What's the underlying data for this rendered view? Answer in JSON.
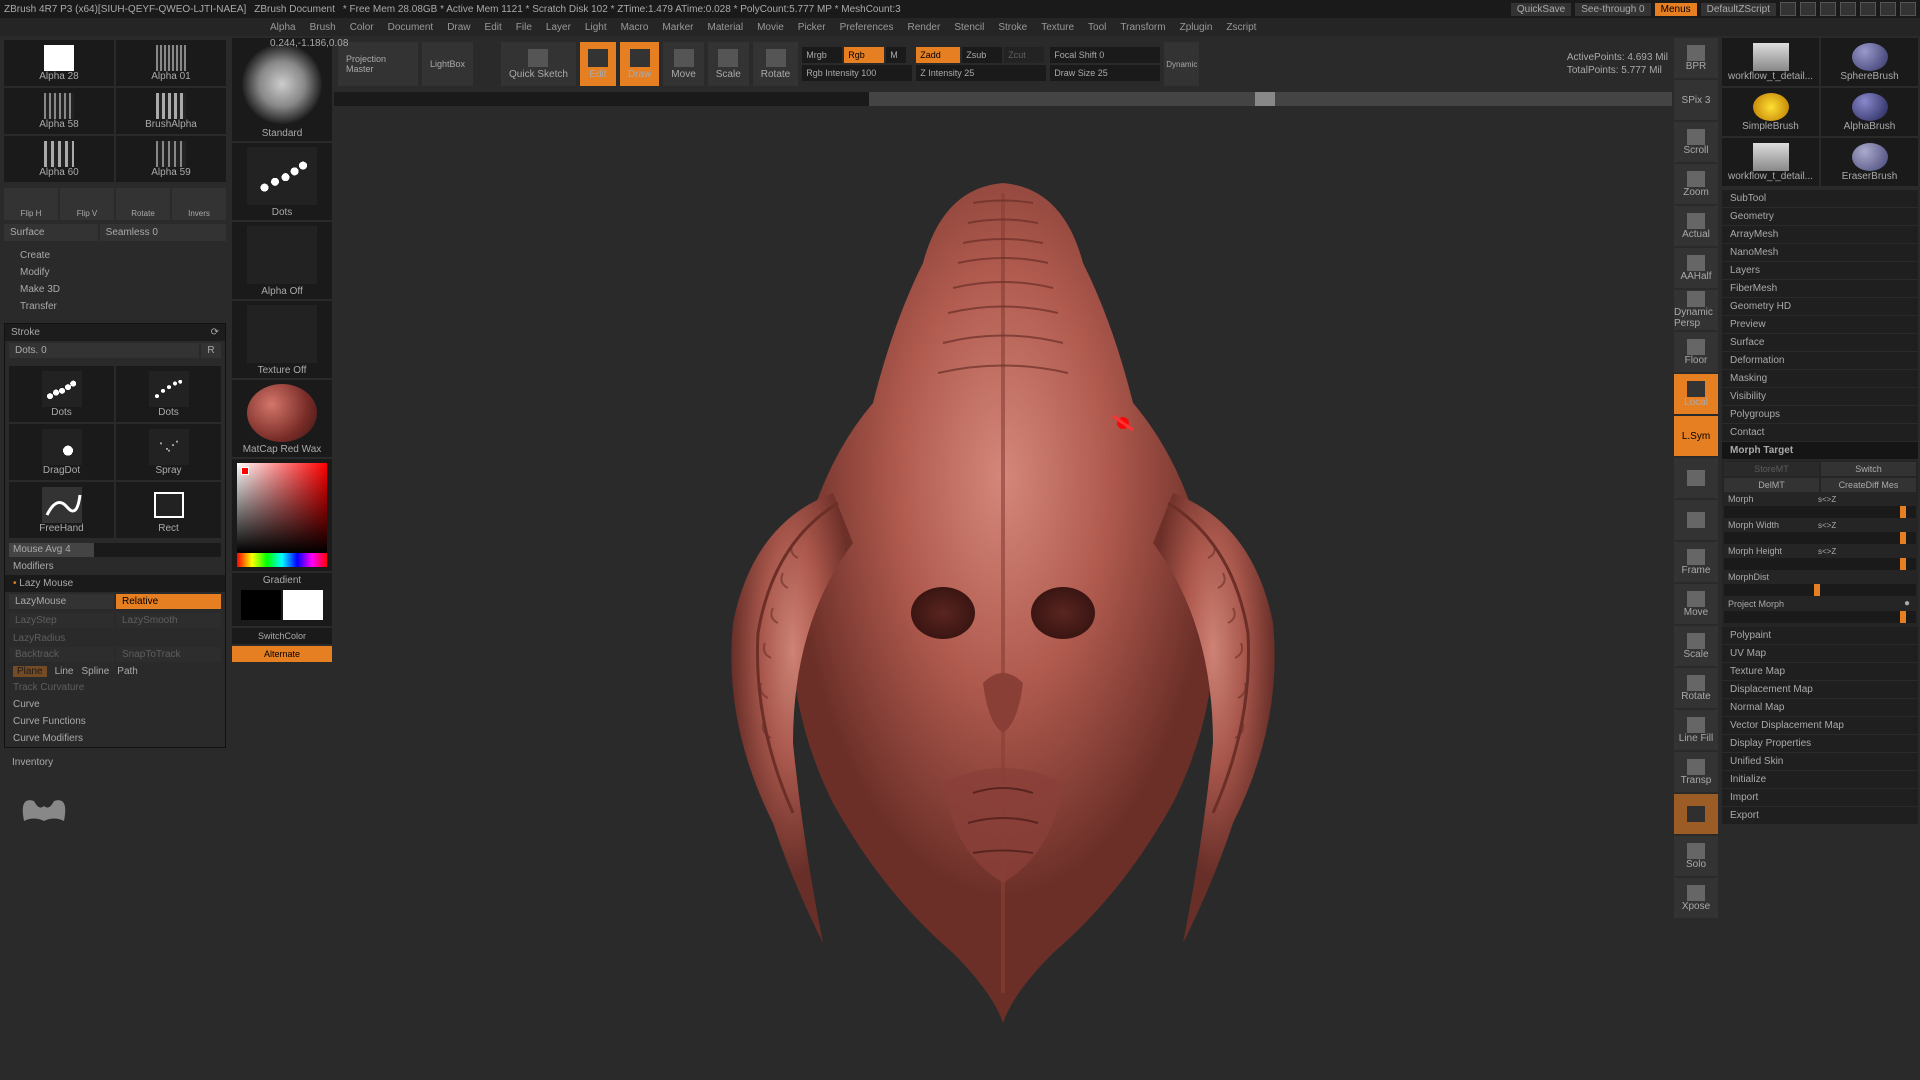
{
  "topbar": {
    "title": "ZBrush 4R7 P3  (x64)[SIUH-QEYF-QWEO-LJTI-NAEA]",
    "doc": "ZBrush Document",
    "stats": "* Free Mem 28.08GB * Active Mem 1121 * Scratch Disk 102 * ZTime:1.479 ATime:0.028 * PolyCount:5.777 MP * MeshCount:3",
    "quicksave": "QuickSave",
    "seethrough": "See-through  0",
    "menus": "Menus",
    "defaultz": "DefaultZScript"
  },
  "menu": [
    "Alpha",
    "Brush",
    "Color",
    "Document",
    "Draw",
    "Edit",
    "File",
    "Layer",
    "Light",
    "Macro",
    "Marker",
    "Material",
    "Movie",
    "Picker",
    "Preferences",
    "Render",
    "Stencil",
    "Stroke",
    "Texture",
    "Tool",
    "Transform",
    "Zplugin",
    "Zscript"
  ],
  "coord": "0.244,-1.186,0.08",
  "alphas": [
    "Alpha 28",
    "Alpha 58",
    "Alpha 60",
    "BrushAlpha",
    "Alpha 01",
    "Alpha 59"
  ],
  "flip": [
    "Flip H",
    "Flip V",
    "Rotate",
    "Invers"
  ],
  "surface": "Surface",
  "seamless": "Seamless 0",
  "actions": [
    "Create",
    "Modify",
    "Make 3D",
    "Transfer"
  ],
  "stroke": {
    "title": "Stroke",
    "dots": "Dots. 0",
    "r": "R",
    "types": [
      "Dots",
      "Dots",
      "DragDot",
      "Spray",
      "FreeHand",
      "Rect"
    ],
    "mouseavg": "Mouse Avg 4",
    "modifiers": "Modifiers",
    "lazymouse": "Lazy Mouse",
    "lazymouse_btn": "LazyMouse",
    "relative": "Relative",
    "lazystep": "LazyStep",
    "lazysmooth": "LazySmooth",
    "lazyradius": "LazyRadius",
    "backtrack": "Backtrack",
    "snaptotrack": "SnapToTrack",
    "opts": [
      "Plane",
      "Line",
      "Spline",
      "Path"
    ],
    "trackcurv": "Track Curvature",
    "curve": "Curve",
    "curvefn": "Curve Functions",
    "curvemod": "Curve Modifiers"
  },
  "inventory": "Inventory",
  "mid": {
    "standard": "Standard",
    "dotslbl": "Dots",
    "alphaoff": "Alpha Off",
    "texoff": "Texture Off",
    "material": "MatCap Red Wax",
    "gradient": "Gradient",
    "switchcolor": "SwitchColor",
    "alternate": "Alternate"
  },
  "tb": {
    "projmaster": "Projection Master",
    "lightbox": "LightBox",
    "quicksketch": "Quick Sketch",
    "edit": "Edit",
    "draw": "Draw",
    "move": "Move",
    "scale": "Scale",
    "rotate": "Rotate",
    "mrgb": "Mrgb",
    "rgb": "Rgb",
    "m": "M",
    "rgbint": "Rgb Intensity 100",
    "zadd": "Zadd",
    "zsub": "Zsub",
    "zcut": "Zcut",
    "zint": "Z Intensity 25",
    "focal": "Focal Shift 0",
    "drawsize": "Draw Size 25",
    "dynamic": "Dynamic",
    "active": "ActivePoints: 4.693 Mil",
    "total": "TotalPoints: 5.777 Mil"
  },
  "nav": [
    "BPR",
    "SPix 3",
    "Scroll",
    "Zoom",
    "Actual",
    "AAHalf",
    "Dynamic Persp",
    "Floor",
    "Local",
    "",
    "",
    "Frame",
    "Move",
    "Scale",
    "Rotate",
    "Line Fill",
    "Transp",
    "",
    "Solo",
    "Xpose"
  ],
  "tools": [
    "SphereBrush",
    "AlphaBrush",
    "SimpleBrush",
    "EraserBrush"
  ],
  "toolthumbs": [
    "workflow_t_detail...",
    "workflow_t_detail..."
  ],
  "rmenu": [
    "SubTool",
    "Geometry",
    "ArrayMesh",
    "NanoMesh",
    "Layers",
    "FiberMesh",
    "Geometry HD",
    "Preview",
    "Surface",
    "Deformation",
    "Masking",
    "Visibility",
    "Polygroups",
    "Contact"
  ],
  "morph": {
    "title": "Morph Target",
    "storemt": "StoreMT",
    "switch": "Switch",
    "delmt": "DelMT",
    "creatediff": "CreateDiff Mes",
    "morph": "Morph",
    "morph_v": "s<>Z",
    "width": "Morph Width",
    "width_v": "s<>Z",
    "height": "Morph Height",
    "height_v": "s<>Z",
    "dist": "MorphDist",
    "proj": "Project Morph"
  },
  "rmenu2": [
    "Polypaint",
    "UV Map",
    "Texture Map",
    "Displacement Map",
    "Normal Map",
    "Vector Displacement Map",
    "Display Properties",
    "Unified Skin",
    "Initialize",
    "Import",
    "Export"
  ]
}
